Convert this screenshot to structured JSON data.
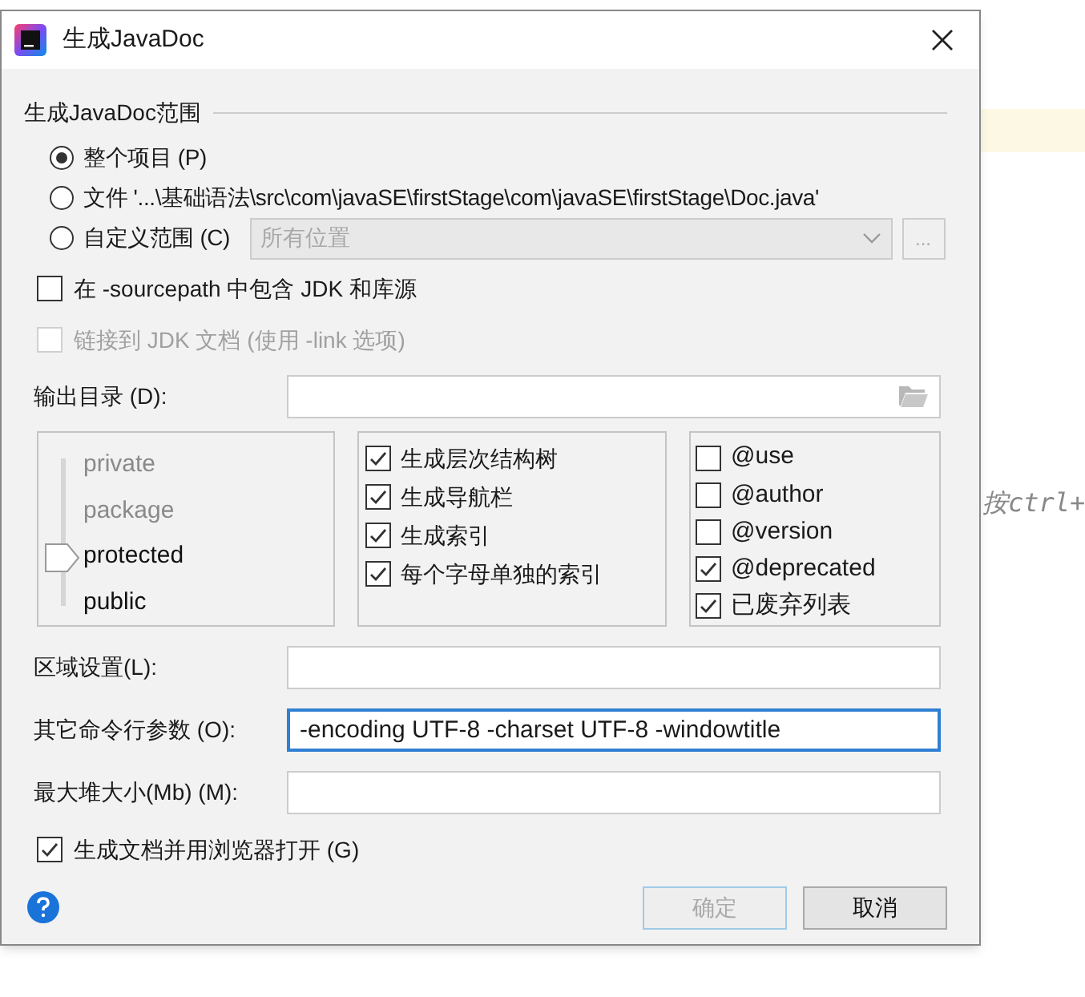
{
  "editor": {
    "hint": "按ctrl+"
  },
  "window": {
    "title": "生成JavaDoc"
  },
  "scope": {
    "title": "生成JavaDoc范围",
    "options": [
      {
        "kind": "plain",
        "label": "整个项目 (P)",
        "selected": true
      },
      {
        "kind": "plain",
        "label": "文件 '...\\基础语法\\src\\com\\javaSE\\firstStage\\com\\javaSE\\firstStage\\Doc.java'",
        "selected": false
      },
      {
        "kind": "custom",
        "label": "自定义范围 (C)",
        "selected": false,
        "dropdown": "所有位置",
        "browse": "..."
      }
    ]
  },
  "include_jdk": {
    "label": "在 -sourcepath 中包含 JDK 和库源",
    "checked": false,
    "disabled": false
  },
  "link_jdk": {
    "label": "链接到 JDK 文档 (使用 -link 选项)",
    "checked": false,
    "disabled": true
  },
  "output_dir": {
    "label": "输出目录 (D):"
  },
  "visibility": [
    {
      "label": "private",
      "selected": false
    },
    {
      "label": "package",
      "selected": false
    },
    {
      "label": "protected",
      "selected": true
    },
    {
      "label": "public",
      "selected": false
    }
  ],
  "generate_options": [
    {
      "label": "生成层次结构树",
      "checked": true
    },
    {
      "label": "生成导航栏",
      "checked": true
    },
    {
      "label": "生成索引",
      "checked": true
    },
    {
      "label": "每个字母单独的索引",
      "checked": true
    }
  ],
  "tag_options": [
    {
      "label": "@use",
      "checked": false
    },
    {
      "label": "@author",
      "checked": false
    },
    {
      "label": "@version",
      "checked": false
    },
    {
      "label": "@deprecated",
      "checked": true
    },
    {
      "label": "已废弃列表",
      "checked": true
    }
  ],
  "fields": [
    {
      "label": "区域设置(L):",
      "focused": false
    },
    {
      "label": "其它命令行参数 (O):",
      "value": "-encoding UTF-8 -charset UTF-8 -windowtitle",
      "focused": true
    },
    {
      "label": "最大堆大小(Mb) (M):",
      "focused": false
    }
  ],
  "open_browser": {
    "label": "生成文档并用浏览器打开 (G)",
    "checked": true
  },
  "buttons": [
    {
      "label": "确定",
      "disabled": true
    },
    {
      "label": "取消",
      "disabled": false
    }
  ]
}
